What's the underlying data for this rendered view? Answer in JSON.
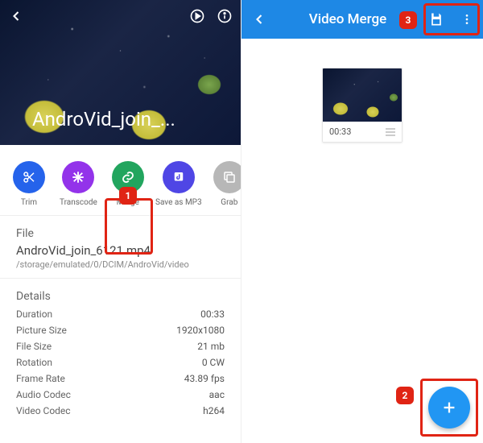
{
  "left": {
    "hero_title": "AndroVid_join_...",
    "actions": [
      {
        "key": "trim",
        "label": "Trim",
        "color": "blue"
      },
      {
        "key": "transcode",
        "label": "Transcode",
        "color": "purple"
      },
      {
        "key": "merge",
        "label": "Merge",
        "color": "green"
      },
      {
        "key": "save_mp3",
        "label": "Save as MP3",
        "color": "indigo"
      },
      {
        "key": "grab",
        "label": "Grab",
        "color": "gray"
      }
    ],
    "file": {
      "heading": "File",
      "name": "AndroVid_join_6121.mp4",
      "path": "/storage/emulated/0/DCIM/AndroVid/video"
    },
    "details": {
      "heading": "Details",
      "rows": [
        {
          "label": "Duration",
          "value": "00:33"
        },
        {
          "label": "Picture Size",
          "value": "1920x1080"
        },
        {
          "label": "File Size",
          "value": "21 mb"
        },
        {
          "label": "Rotation",
          "value": "0 CW"
        },
        {
          "label": "Frame Rate",
          "value": "43.89 fps"
        },
        {
          "label": "Audio Codec",
          "value": "aac"
        },
        {
          "label": "Video Codec",
          "value": "h264"
        }
      ]
    }
  },
  "right": {
    "title": "Video Merge",
    "clip": {
      "duration": "00:33"
    }
  },
  "callouts": {
    "c1": "1",
    "c2": "2",
    "c3": "3"
  }
}
